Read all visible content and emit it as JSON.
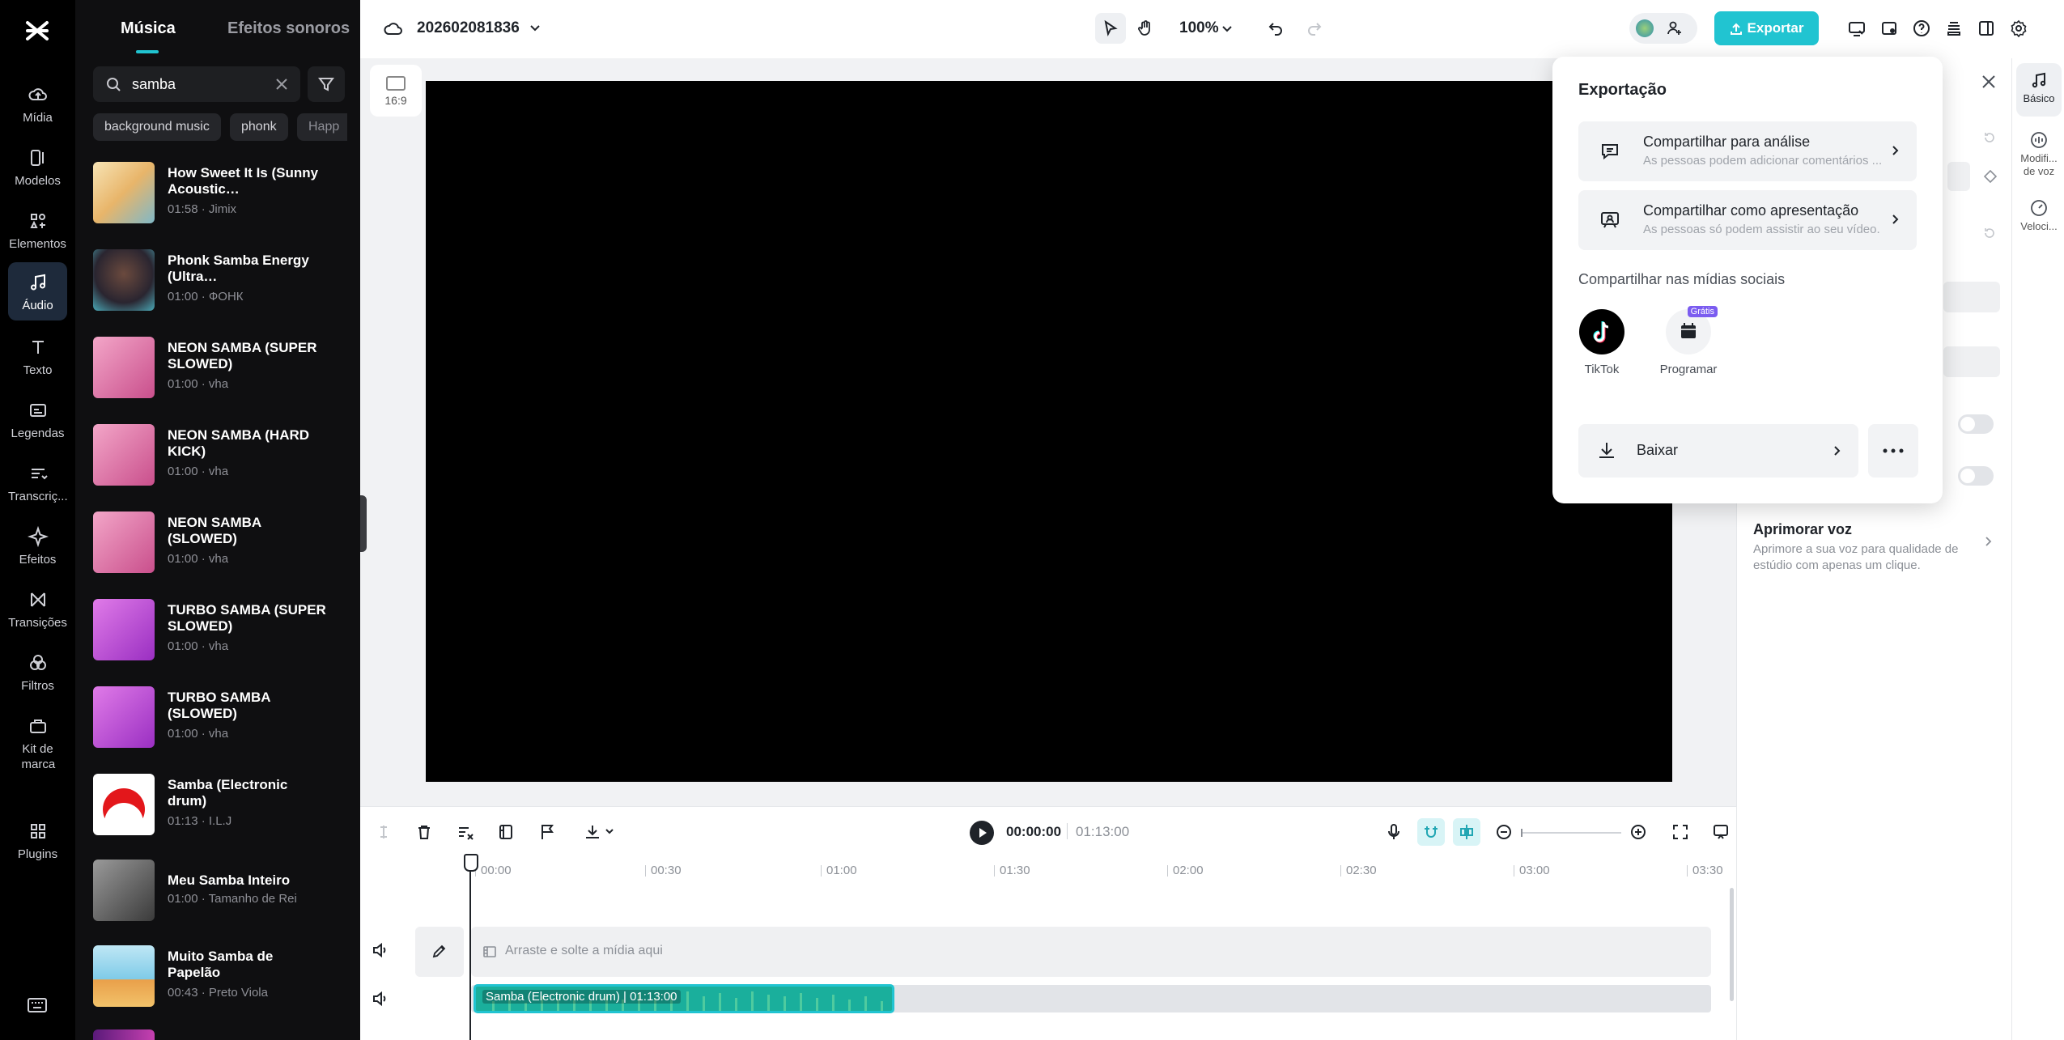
{
  "rail": {
    "items": [
      {
        "label": "Mídia"
      },
      {
        "label": "Modelos"
      },
      {
        "label": "Elementos"
      },
      {
        "label": "Áudio"
      },
      {
        "label": "Texto"
      },
      {
        "label": "Legendas"
      },
      {
        "label": "Transcriç..."
      },
      {
        "label": "Efeitos"
      },
      {
        "label": "Transições"
      },
      {
        "label": "Filtros"
      },
      {
        "label": "Kit de marca"
      },
      {
        "label": "Plugins"
      }
    ]
  },
  "panel": {
    "tabs": [
      "Música",
      "Efeitos sonoros"
    ],
    "search": {
      "value": "samba"
    },
    "chips": [
      "background music",
      "phonk",
      "Happ"
    ],
    "tracks": [
      {
        "title": "How Sweet It Is (Sunny Acoustic…",
        "meta": "01:58 · Jimix"
      },
      {
        "title": "Phonk Samba Energy (Ultra…",
        "meta": "01:00 · ФОНК"
      },
      {
        "title": "NEON SAMBA (SUPER SLOWED)",
        "meta": "01:00 · vha"
      },
      {
        "title": "NEON SAMBA (HARD KICK)",
        "meta": "01:00 · vha"
      },
      {
        "title": "NEON SAMBA (SLOWED)",
        "meta": "01:00 · vha"
      },
      {
        "title": "TURBO SAMBA (SUPER SLOWED)",
        "meta": "01:00 · vha"
      },
      {
        "title": "TURBO SAMBA (SLOWED)",
        "meta": "01:00 · vha"
      },
      {
        "title": "Samba (Electronic drum)",
        "meta": "01:13 · I.L.J"
      },
      {
        "title": "Meu Samba Inteiro",
        "meta": "01:00 · Tamanho de Rei"
      },
      {
        "title": "Muito Samba de Papelão",
        "meta": "00:43 · Preto Viola"
      }
    ]
  },
  "topbar": {
    "project_name": "202602081836",
    "zoom": "100%",
    "export_label": "Exportar"
  },
  "canvas": {
    "ratio": "16:9"
  },
  "timeline": {
    "current_time": "00:00:00",
    "total_time": "01:13:00",
    "ruler": [
      "00:00",
      "00:30",
      "01:00",
      "01:30",
      "02:00",
      "02:30",
      "03:00",
      "03:30"
    ],
    "drop_hint": "Arraste e solte a mídia aqui",
    "clip": {
      "name": "Samba (Electronic drum)",
      "duration": "01:13:00"
    }
  },
  "right_panel": {
    "enhance_title": "Aprimorar voz",
    "enhance_desc": "Aprimore a sua voz para qualidade de estúdio com apenas um clique.",
    "rail": [
      {
        "label": "Básico"
      },
      {
        "label": "Modifi... de voz"
      },
      {
        "label": "Veloci..."
      }
    ]
  },
  "export_popup": {
    "title": "Exportação",
    "items": [
      {
        "title": "Compartilhar para análise",
        "desc": "As pessoas podem adicionar comentários ..."
      },
      {
        "title": "Compartilhar como apresentação",
        "desc": "As pessoas só podem assistir ao seu vídeo."
      }
    ],
    "social_title": "Compartilhar nas mídias sociais",
    "social": [
      {
        "label": "TikTok"
      },
      {
        "label": "Programar",
        "badge": "Grátis"
      }
    ],
    "download_label": "Baixar"
  },
  "colors": {
    "accent": "#21c4d1",
    "clip": "#1aaf9c",
    "rail_bg": "#000000",
    "panel_bg": "#0f0f11"
  }
}
